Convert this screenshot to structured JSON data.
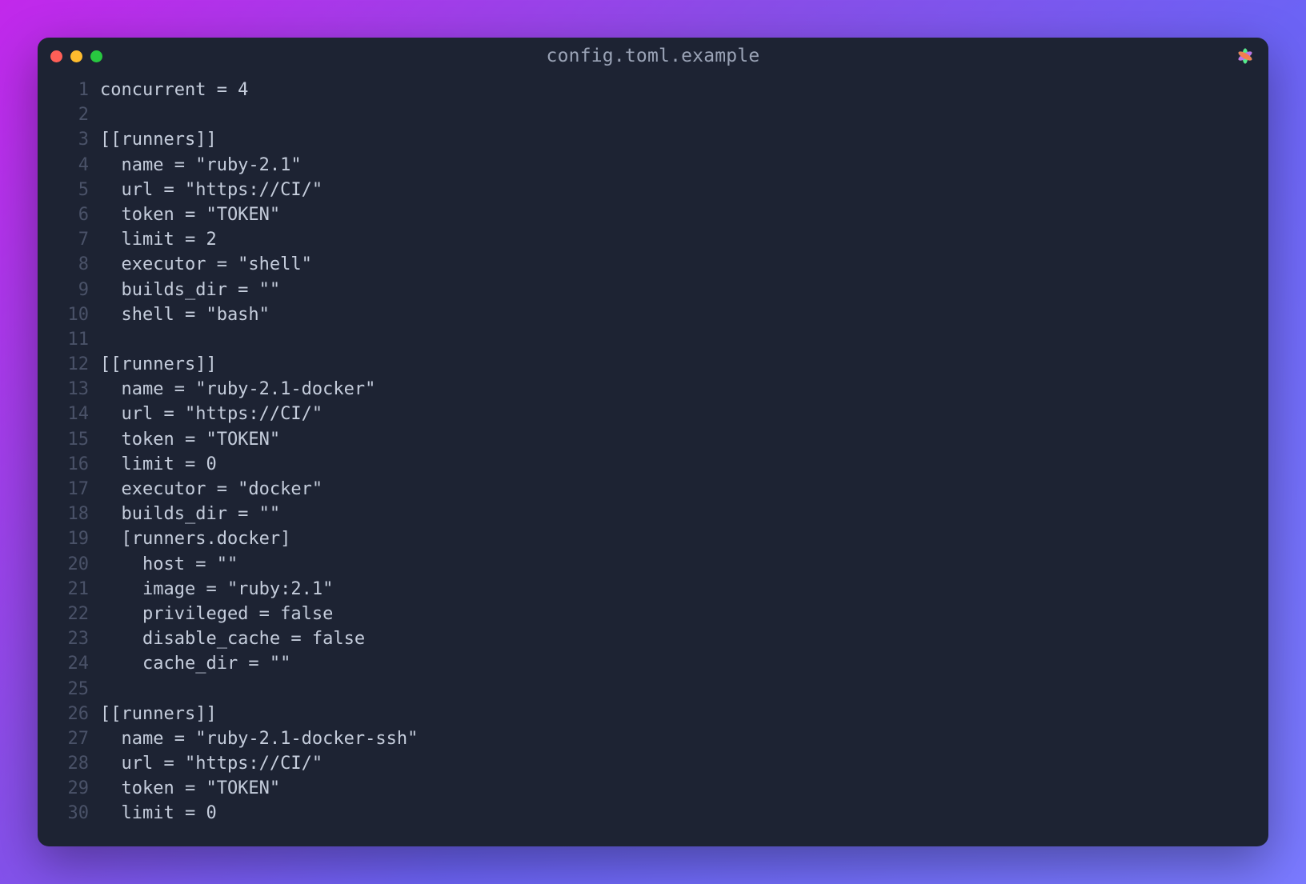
{
  "window": {
    "title": "config.toml.example"
  },
  "colors": {
    "bg_window": "#1d2333",
    "text_code": "#c5cddc",
    "text_gutter": "#4a5268",
    "traffic_close": "#ff5f57",
    "traffic_min": "#febc2e",
    "traffic_zoom": "#28c840"
  },
  "code_lines": [
    "concurrent = 4",
    "",
    "[[runners]]",
    "  name = \"ruby-2.1\"",
    "  url = \"https://CI/\"",
    "  token = \"TOKEN\"",
    "  limit = 2",
    "  executor = \"shell\"",
    "  builds_dir = \"\"",
    "  shell = \"bash\"",
    "",
    "[[runners]]",
    "  name = \"ruby-2.1-docker\"",
    "  url = \"https://CI/\"",
    "  token = \"TOKEN\"",
    "  limit = 0",
    "  executor = \"docker\"",
    "  builds_dir = \"\"",
    "  [runners.docker]",
    "    host = \"\"",
    "    image = \"ruby:2.1\"",
    "    privileged = false",
    "    disable_cache = false",
    "    cache_dir = \"\"",
    "",
    "[[runners]]",
    "  name = \"ruby-2.1-docker-ssh\"",
    "  url = \"https://CI/\"",
    "  token = \"TOKEN\"",
    "  limit = 0"
  ]
}
